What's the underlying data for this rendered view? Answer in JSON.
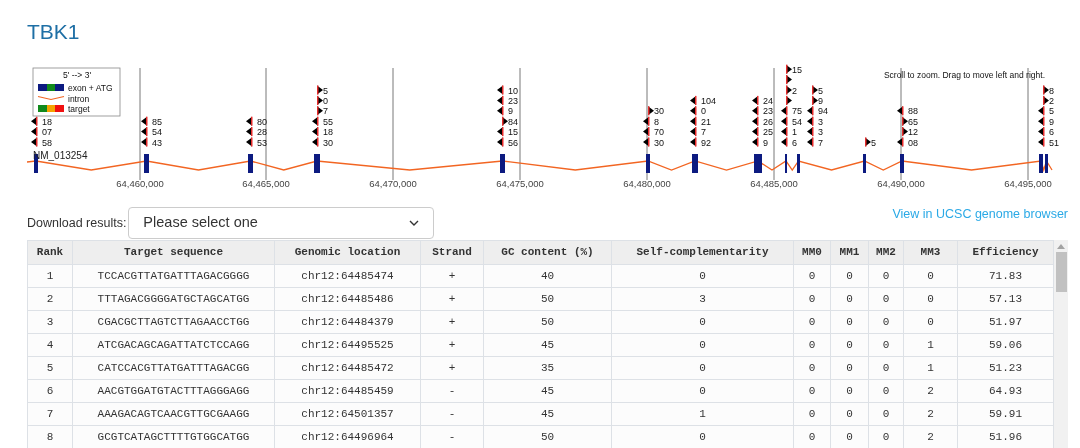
{
  "title": "TBK1",
  "track": {
    "legend": {
      "title": "5' --> 3'",
      "items": [
        {
          "kind": "exon",
          "label": "exon + ATG"
        },
        {
          "kind": "intron",
          "label": "intron"
        },
        {
          "kind": "target",
          "label": "target"
        }
      ]
    },
    "gene": "NM_013254",
    "note": "Scroll to zoom. Drag to move left and right.",
    "axis_ticks": [
      "64,460,000",
      "64,465,000",
      "64,470,000",
      "64,475,000",
      "64,480,000",
      "64,485,000",
      "64,490,000",
      "64,495,000"
    ],
    "target_stacks": [
      {
        "markers": [
          {
            "reverse": true,
            "label": "18"
          },
          {
            "reverse": true,
            "label": "07"
          },
          {
            "reverse": true,
            "label": "58"
          }
        ]
      },
      {
        "markers": [
          {
            "reverse": true,
            "label": "85"
          },
          {
            "reverse": true,
            "label": "54"
          },
          {
            "reverse": true,
            "label": "43"
          }
        ]
      },
      {
        "markers": [
          {
            "reverse": true,
            "label": "80"
          },
          {
            "reverse": true,
            "label": "28"
          },
          {
            "reverse": true,
            "label": "53"
          }
        ]
      },
      {
        "markers": [
          {
            "reverse": false,
            "label": "5"
          },
          {
            "reverse": false,
            "label": "0"
          },
          {
            "reverse": false,
            "label": "7"
          },
          {
            "reverse": true,
            "label": "55"
          },
          {
            "reverse": true,
            "label": "18"
          },
          {
            "reverse": true,
            "label": "30"
          }
        ]
      },
      {
        "markers": [
          {
            "reverse": true,
            "label": "10"
          },
          {
            "reverse": true,
            "label": "23"
          },
          {
            "reverse": true,
            "label": "9"
          },
          {
            "reverse": false,
            "label": "84"
          },
          {
            "reverse": true,
            "label": "15"
          },
          {
            "reverse": true,
            "label": "56"
          }
        ]
      },
      {
        "markers": [
          {
            "reverse": false,
            "label": "30"
          },
          {
            "reverse": true,
            "label": "8"
          },
          {
            "reverse": true,
            "label": "70"
          },
          {
            "reverse": true,
            "label": "30"
          }
        ]
      },
      {
        "markers": [
          {
            "reverse": true,
            "label": "104"
          },
          {
            "reverse": true,
            "label": "0"
          },
          {
            "reverse": true,
            "label": "21"
          },
          {
            "reverse": true,
            "label": "7"
          },
          {
            "reverse": true,
            "label": "92"
          }
        ]
      },
      {
        "markers": [
          {
            "reverse": true,
            "label": "24"
          },
          {
            "reverse": true,
            "label": "23"
          },
          {
            "reverse": true,
            "label": "26"
          },
          {
            "reverse": true,
            "label": "25"
          },
          {
            "reverse": true,
            "label": "9"
          }
        ]
      },
      {
        "markers": [
          {
            "reverse": false,
            "label": "15"
          },
          {
            "reverse": false
          },
          {
            "reverse": false,
            "label": "2"
          },
          {
            "reverse": false
          },
          {
            "reverse": true,
            "label": "75"
          },
          {
            "reverse": true,
            "label": "54"
          },
          {
            "reverse": true,
            "label": "1"
          },
          {
            "reverse": true,
            "label": "6"
          }
        ]
      },
      {
        "markers": [
          {
            "reverse": false,
            "label": "5"
          },
          {
            "reverse": false,
            "label": "9"
          },
          {
            "reverse": true,
            "label": "94"
          },
          {
            "reverse": true,
            "label": "3"
          },
          {
            "reverse": true,
            "label": "3"
          },
          {
            "reverse": true,
            "label": "7"
          }
        ]
      },
      {
        "markers": [
          {
            "reverse": false,
            "label": "5"
          }
        ]
      },
      {
        "markers": [
          {
            "reverse": true,
            "label": "88"
          },
          {
            "reverse": false,
            "label": "65"
          },
          {
            "reverse": false,
            "label": "12"
          },
          {
            "reverse": true,
            "label": "08"
          }
        ]
      },
      {
        "markers": [
          {
            "reverse": false,
            "label": "8"
          },
          {
            "reverse": false,
            "label": "2"
          },
          {
            "reverse": true,
            "label": "5"
          },
          {
            "reverse": true,
            "label": "9"
          },
          {
            "reverse": true,
            "label": "6"
          },
          {
            "reverse": true,
            "label": "51"
          }
        ]
      }
    ]
  },
  "download": {
    "label": "Download results:",
    "select_value": "Please select one"
  },
  "ucsc_link": "View in UCSC genome browser",
  "table": {
    "columns": [
      "Rank",
      "Target sequence",
      "Genomic location",
      "Strand",
      "GC content (%)",
      "Self-complementarity",
      "MM0",
      "MM1",
      "MM2",
      "MM3",
      "Efficiency"
    ],
    "rows": [
      [
        "1",
        "TCCACGTTATGATTTAGACGGGG",
        "chr12:64485474",
        "+",
        "40",
        "0",
        "0",
        "0",
        "0",
        "0",
        "71.83"
      ],
      [
        "2",
        "TTTAGACGGGGATGCTAGCATGG",
        "chr12:64485486",
        "+",
        "50",
        "3",
        "0",
        "0",
        "0",
        "0",
        "57.13"
      ],
      [
        "3",
        "CGACGCTTAGTCTTAGAACCTGG",
        "chr12:64484379",
        "+",
        "50",
        "0",
        "0",
        "0",
        "0",
        "0",
        "51.97"
      ],
      [
        "4",
        "ATCGACAGCAGATTATCTCCAGG",
        "chr12:64495525",
        "+",
        "45",
        "0",
        "0",
        "0",
        "0",
        "1",
        "59.06"
      ],
      [
        "5",
        "CATCCACGTTATGATTTAGACGG",
        "chr12:64485472",
        "+",
        "35",
        "0",
        "0",
        "0",
        "0",
        "1",
        "51.23"
      ],
      [
        "6",
        "AACGTGGATGTACTTTAGGGAGG",
        "chr12:64485459",
        "-",
        "45",
        "0",
        "0",
        "0",
        "0",
        "2",
        "64.93"
      ],
      [
        "7",
        "AAAGACAGTCAACGTTGCGAAGG",
        "chr12:64501357",
        "-",
        "45",
        "1",
        "0",
        "0",
        "0",
        "2",
        "59.91"
      ],
      [
        "8",
        "GCGTCATAGCTTTTGTGGCATGG",
        "chr12:64496964",
        "-",
        "50",
        "0",
        "0",
        "0",
        "0",
        "2",
        "51.96"
      ]
    ]
  }
}
